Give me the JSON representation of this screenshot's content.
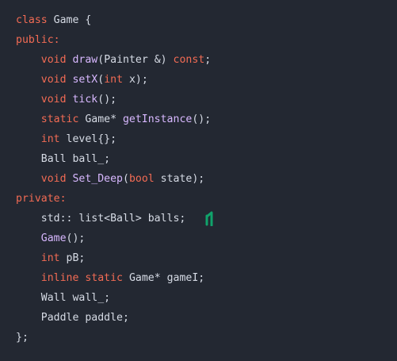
{
  "colors": {
    "background": "#232832",
    "text": "#d6dbe5",
    "keyword": "#f26b54",
    "function": "#d8b8ff",
    "marker": "#10a36b"
  },
  "code": {
    "lines": [
      [
        {
          "t": "class",
          "k": "kw"
        },
        {
          "t": " Game {",
          "k": "txt"
        }
      ],
      [
        {
          "t": "public:",
          "k": "kw"
        }
      ],
      [
        {
          "t": "    ",
          "k": "txt"
        },
        {
          "t": "void",
          "k": "kw"
        },
        {
          "t": " ",
          "k": "txt"
        },
        {
          "t": "draw",
          "k": "fn"
        },
        {
          "t": "(Painter &) ",
          "k": "txt"
        },
        {
          "t": "const",
          "k": "kw"
        },
        {
          "t": ";",
          "k": "txt"
        }
      ],
      [
        {
          "t": "    ",
          "k": "txt"
        },
        {
          "t": "void",
          "k": "kw"
        },
        {
          "t": " ",
          "k": "txt"
        },
        {
          "t": "setX",
          "k": "fn"
        },
        {
          "t": "(",
          "k": "txt"
        },
        {
          "t": "int",
          "k": "kw"
        },
        {
          "t": " x);",
          "k": "txt"
        }
      ],
      [
        {
          "t": "    ",
          "k": "txt"
        },
        {
          "t": "void",
          "k": "kw"
        },
        {
          "t": " ",
          "k": "txt"
        },
        {
          "t": "tick",
          "k": "fn"
        },
        {
          "t": "();",
          "k": "txt"
        }
      ],
      [
        {
          "t": "    ",
          "k": "txt"
        },
        {
          "t": "static",
          "k": "kw"
        },
        {
          "t": " Game* ",
          "k": "txt"
        },
        {
          "t": "getInstance",
          "k": "fn"
        },
        {
          "t": "();",
          "k": "txt"
        }
      ],
      [
        {
          "t": "    ",
          "k": "txt"
        },
        {
          "t": "int",
          "k": "kw"
        },
        {
          "t": " level{};",
          "k": "txt"
        }
      ],
      [
        {
          "t": "    Ball ball_;",
          "k": "txt"
        }
      ],
      [
        {
          "t": "    ",
          "k": "txt"
        },
        {
          "t": "void",
          "k": "kw"
        },
        {
          "t": " ",
          "k": "txt"
        },
        {
          "t": "Set_Deep",
          "k": "fn"
        },
        {
          "t": "(",
          "k": "txt"
        },
        {
          "t": "bool",
          "k": "kw"
        },
        {
          "t": " state);",
          "k": "txt"
        }
      ],
      [
        {
          "t": "private:",
          "k": "kw"
        }
      ],
      [
        {
          "t": "    std:: list<Ball> balls;",
          "k": "txt"
        }
      ],
      [
        {
          "t": "    ",
          "k": "txt"
        },
        {
          "t": "Game",
          "k": "fn"
        },
        {
          "t": "();",
          "k": "txt"
        }
      ],
      [
        {
          "t": "    ",
          "k": "txt"
        },
        {
          "t": "int",
          "k": "kw"
        },
        {
          "t": " pB;",
          "k": "txt"
        }
      ],
      [
        {
          "t": "    ",
          "k": "txt"
        },
        {
          "t": "inline",
          "k": "kw"
        },
        {
          "t": " ",
          "k": "txt"
        },
        {
          "t": "static",
          "k": "kw"
        },
        {
          "t": " Game* gameI;",
          "k": "txt"
        }
      ],
      [
        {
          "t": "    Wall wall_;",
          "k": "txt"
        }
      ],
      [
        {
          "t": "    Paddle paddle;",
          "k": "txt"
        }
      ],
      [
        {
          "t": "};",
          "k": "txt"
        }
      ]
    ]
  }
}
